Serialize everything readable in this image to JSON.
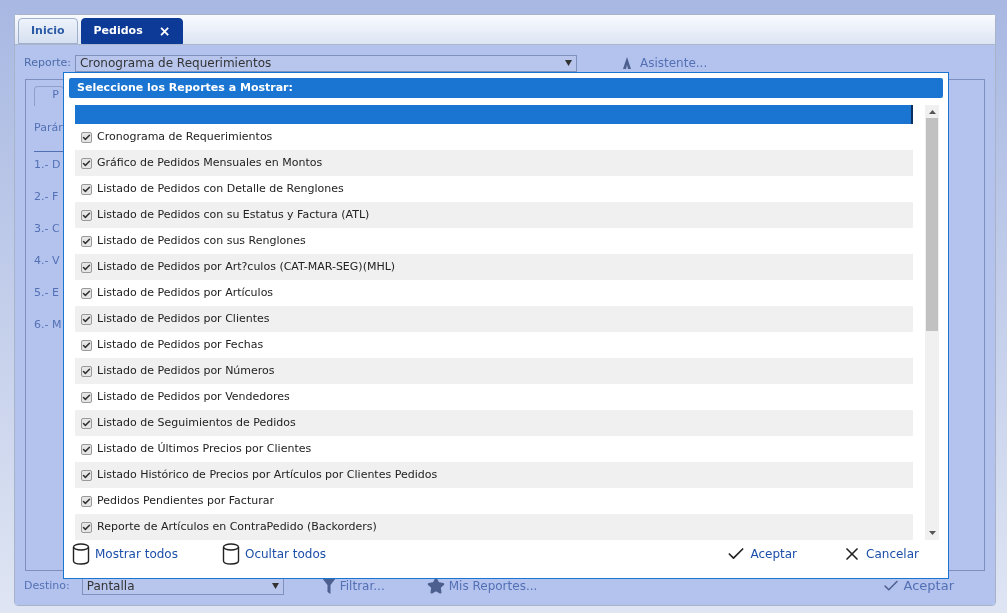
{
  "tabs": [
    {
      "label": "Inicio",
      "selected": false,
      "closable": false
    },
    {
      "label": "Pedidos",
      "selected": true,
      "closable": true,
      "close_icon": "×"
    }
  ],
  "report": {
    "label": "Reporte:",
    "value": "Cronograma de Requerimientos"
  },
  "assistant": "Asistente...",
  "left_panel": {
    "tab": "P",
    "heading": "Parán",
    "items": [
      "1.- D",
      "2.- F",
      "3.- C",
      "4.- V",
      "5.- E",
      "6.- M"
    ]
  },
  "dialog": {
    "title": "Seleccione los Reportes a Mostrar:",
    "items": [
      {
        "label": "Cronograma de Requerimientos",
        "checked": true
      },
      {
        "label": "Gráfico de Pedidos Mensuales en Montos",
        "checked": true
      },
      {
        "label": "Listado de Pedidos con Detalle de Renglones",
        "checked": true
      },
      {
        "label": "Listado de Pedidos con su Estatus y Factura (ATL)",
        "checked": true
      },
      {
        "label": "Listado de Pedidos con sus Renglones",
        "checked": true
      },
      {
        "label": "Listado de Pedidos por Art?culos (CAT-MAR-SEG)(MHL)",
        "checked": true
      },
      {
        "label": "Listado de Pedidos por Artículos",
        "checked": true
      },
      {
        "label": "Listado de Pedidos por Clientes",
        "checked": true
      },
      {
        "label": "Listado de Pedidos por Fechas",
        "checked": true
      },
      {
        "label": "Listado de Pedidos por Números",
        "checked": true
      },
      {
        "label": "Listado de Pedidos por Vendedores",
        "checked": true
      },
      {
        "label": "Listado de Seguimientos de Pedidos",
        "checked": true
      },
      {
        "label": "Listado de Últimos Precios por Clientes",
        "checked": true
      },
      {
        "label": "Listado Histórico de Precios por Artículos por Clientes Pedidos",
        "checked": true
      },
      {
        "label": "Pedidos Pendientes por Facturar",
        "checked": true
      },
      {
        "label": "Reporte de Artículos en ContraPedido (Backorders)",
        "checked": true
      }
    ],
    "show_all": "Mostrar todos",
    "hide_all": "Ocultar todos",
    "accept": "Aceptar",
    "cancel": "Cancelar"
  },
  "footer": {
    "destination_label": "Destino:",
    "destination": "Pantalla",
    "filter": "Filtrar...",
    "my_reports": "Mis Reportes...",
    "accept": "Aceptar"
  }
}
